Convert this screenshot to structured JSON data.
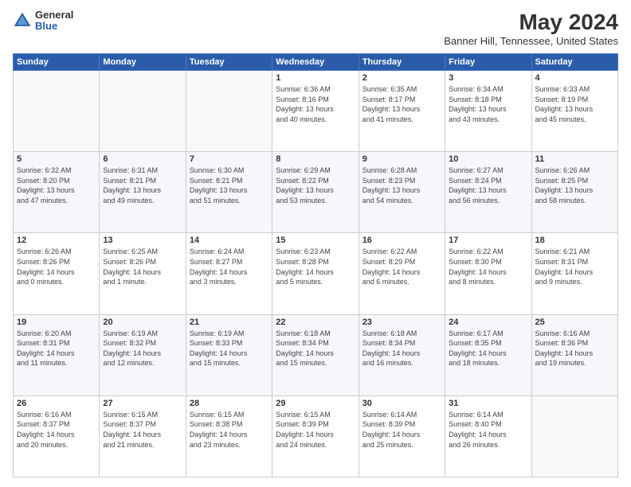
{
  "header": {
    "logo_general": "General",
    "logo_blue": "Blue",
    "month_year": "May 2024",
    "location": "Banner Hill, Tennessee, United States"
  },
  "days_of_week": [
    "Sunday",
    "Monday",
    "Tuesday",
    "Wednesday",
    "Thursday",
    "Friday",
    "Saturday"
  ],
  "weeks": [
    [
      {
        "day": "",
        "info": ""
      },
      {
        "day": "",
        "info": ""
      },
      {
        "day": "",
        "info": ""
      },
      {
        "day": "1",
        "info": "Sunrise: 6:36 AM\nSunset: 8:16 PM\nDaylight: 13 hours\nand 40 minutes."
      },
      {
        "day": "2",
        "info": "Sunrise: 6:35 AM\nSunset: 8:17 PM\nDaylight: 13 hours\nand 41 minutes."
      },
      {
        "day": "3",
        "info": "Sunrise: 6:34 AM\nSunset: 8:18 PM\nDaylight: 13 hours\nand 43 minutes."
      },
      {
        "day": "4",
        "info": "Sunrise: 6:33 AM\nSunset: 8:19 PM\nDaylight: 13 hours\nand 45 minutes."
      }
    ],
    [
      {
        "day": "5",
        "info": "Sunrise: 6:32 AM\nSunset: 8:20 PM\nDaylight: 13 hours\nand 47 minutes."
      },
      {
        "day": "6",
        "info": "Sunrise: 6:31 AM\nSunset: 8:21 PM\nDaylight: 13 hours\nand 49 minutes."
      },
      {
        "day": "7",
        "info": "Sunrise: 6:30 AM\nSunset: 8:21 PM\nDaylight: 13 hours\nand 51 minutes."
      },
      {
        "day": "8",
        "info": "Sunrise: 6:29 AM\nSunset: 8:22 PM\nDaylight: 13 hours\nand 53 minutes."
      },
      {
        "day": "9",
        "info": "Sunrise: 6:28 AM\nSunset: 8:23 PM\nDaylight: 13 hours\nand 54 minutes."
      },
      {
        "day": "10",
        "info": "Sunrise: 6:27 AM\nSunset: 8:24 PM\nDaylight: 13 hours\nand 56 minutes."
      },
      {
        "day": "11",
        "info": "Sunrise: 6:26 AM\nSunset: 8:25 PM\nDaylight: 13 hours\nand 58 minutes."
      }
    ],
    [
      {
        "day": "12",
        "info": "Sunrise: 6:26 AM\nSunset: 8:26 PM\nDaylight: 14 hours\nand 0 minutes."
      },
      {
        "day": "13",
        "info": "Sunrise: 6:25 AM\nSunset: 8:26 PM\nDaylight: 14 hours\nand 1 minute."
      },
      {
        "day": "14",
        "info": "Sunrise: 6:24 AM\nSunset: 8:27 PM\nDaylight: 14 hours\nand 3 minutes."
      },
      {
        "day": "15",
        "info": "Sunrise: 6:23 AM\nSunset: 8:28 PM\nDaylight: 14 hours\nand 5 minutes."
      },
      {
        "day": "16",
        "info": "Sunrise: 6:22 AM\nSunset: 8:29 PM\nDaylight: 14 hours\nand 6 minutes."
      },
      {
        "day": "17",
        "info": "Sunrise: 6:22 AM\nSunset: 8:30 PM\nDaylight: 14 hours\nand 8 minutes."
      },
      {
        "day": "18",
        "info": "Sunrise: 6:21 AM\nSunset: 8:31 PM\nDaylight: 14 hours\nand 9 minutes."
      }
    ],
    [
      {
        "day": "19",
        "info": "Sunrise: 6:20 AM\nSunset: 8:31 PM\nDaylight: 14 hours\nand 11 minutes."
      },
      {
        "day": "20",
        "info": "Sunrise: 6:19 AM\nSunset: 8:32 PM\nDaylight: 14 hours\nand 12 minutes."
      },
      {
        "day": "21",
        "info": "Sunrise: 6:19 AM\nSunset: 8:33 PM\nDaylight: 14 hours\nand 15 minutes."
      },
      {
        "day": "22",
        "info": "Sunrise: 6:18 AM\nSunset: 8:34 PM\nDaylight: 14 hours\nand 15 minutes."
      },
      {
        "day": "23",
        "info": "Sunrise: 6:18 AM\nSunset: 8:34 PM\nDaylight: 14 hours\nand 16 minutes."
      },
      {
        "day": "24",
        "info": "Sunrise: 6:17 AM\nSunset: 8:35 PM\nDaylight: 14 hours\nand 18 minutes."
      },
      {
        "day": "25",
        "info": "Sunrise: 6:16 AM\nSunset: 8:36 PM\nDaylight: 14 hours\nand 19 minutes."
      }
    ],
    [
      {
        "day": "26",
        "info": "Sunrise: 6:16 AM\nSunset: 8:37 PM\nDaylight: 14 hours\nand 20 minutes."
      },
      {
        "day": "27",
        "info": "Sunrise: 6:15 AM\nSunset: 8:37 PM\nDaylight: 14 hours\nand 21 minutes."
      },
      {
        "day": "28",
        "info": "Sunrise: 6:15 AM\nSunset: 8:38 PM\nDaylight: 14 hours\nand 23 minutes."
      },
      {
        "day": "29",
        "info": "Sunrise: 6:15 AM\nSunset: 8:39 PM\nDaylight: 14 hours\nand 24 minutes."
      },
      {
        "day": "30",
        "info": "Sunrise: 6:14 AM\nSunset: 8:39 PM\nDaylight: 14 hours\nand 25 minutes."
      },
      {
        "day": "31",
        "info": "Sunrise: 6:14 AM\nSunset: 8:40 PM\nDaylight: 14 hours\nand 26 minutes."
      },
      {
        "day": "",
        "info": ""
      }
    ]
  ]
}
